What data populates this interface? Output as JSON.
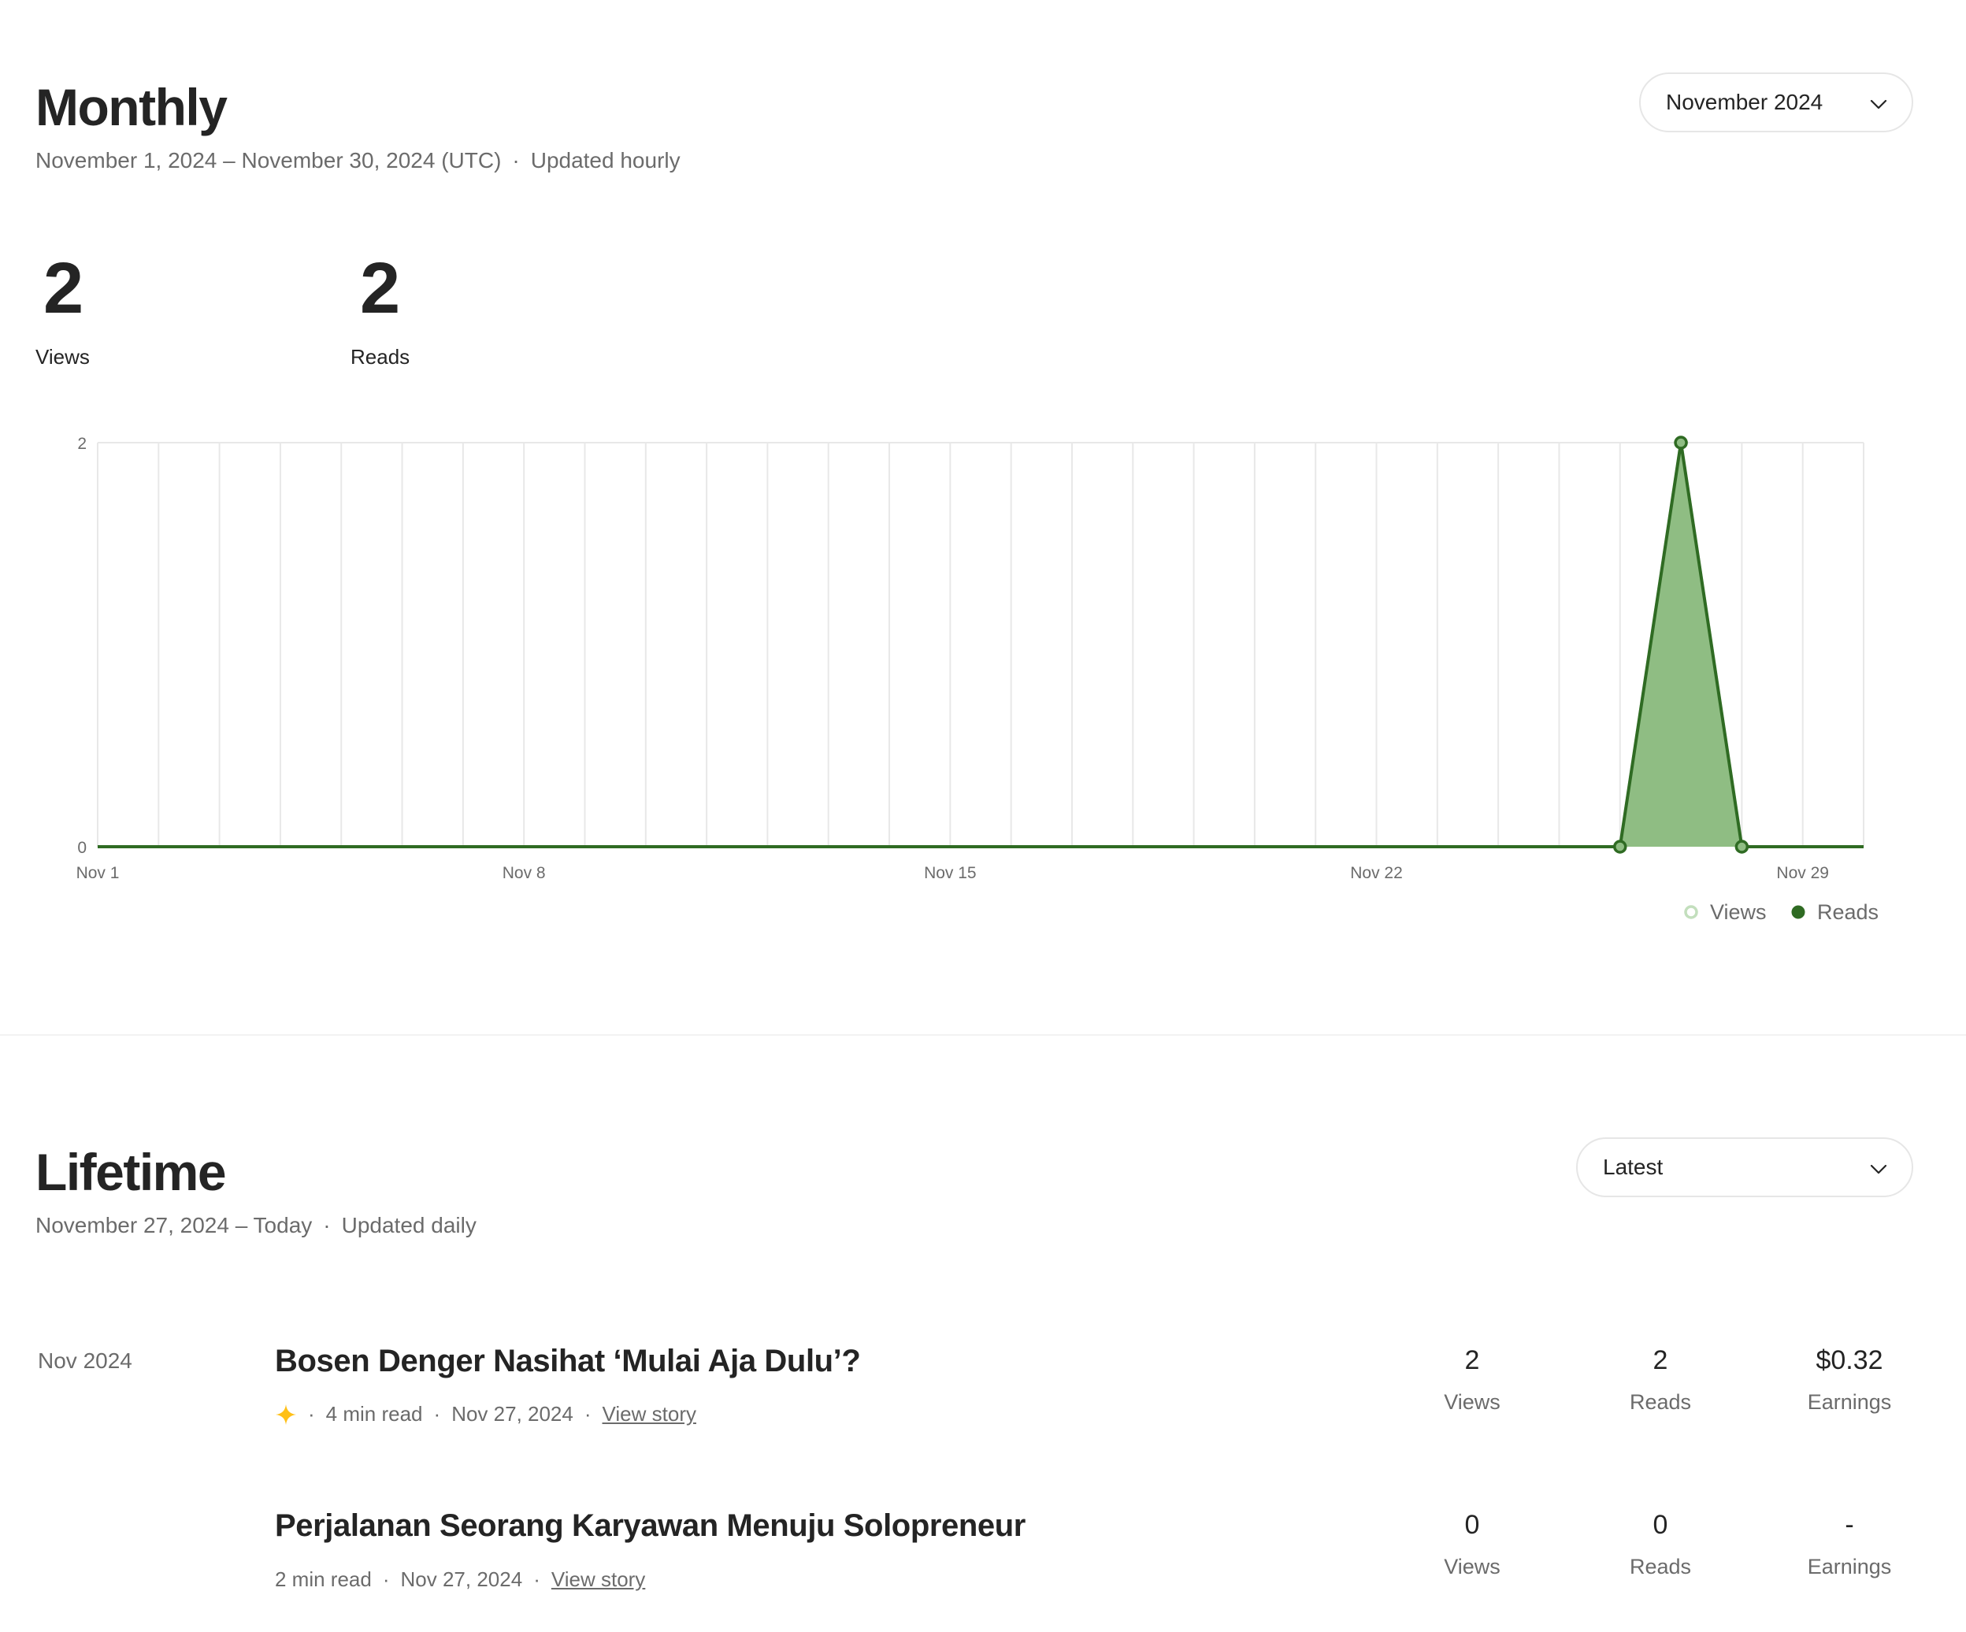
{
  "monthly": {
    "title": "Monthly",
    "range": "November 1, 2024 – November 30, 2024 (UTC)",
    "separator": "·",
    "update_note": "Updated hourly",
    "month_selector": "November 2024",
    "totals": [
      {
        "value": "2",
        "label": "Views"
      },
      {
        "value": "2",
        "label": "Reads"
      }
    ]
  },
  "chart_data": {
    "type": "area",
    "x": [
      "Nov 1",
      "Nov 2",
      "Nov 3",
      "Nov 4",
      "Nov 5",
      "Nov 6",
      "Nov 7",
      "Nov 8",
      "Nov 9",
      "Nov 10",
      "Nov 11",
      "Nov 12",
      "Nov 13",
      "Nov 14",
      "Nov 15",
      "Nov 16",
      "Nov 17",
      "Nov 18",
      "Nov 19",
      "Nov 20",
      "Nov 21",
      "Nov 22",
      "Nov 23",
      "Nov 24",
      "Nov 25",
      "Nov 26",
      "Nov 27",
      "Nov 28",
      "Nov 29",
      "Nov 30"
    ],
    "x_tick_labels": [
      "Nov 1",
      "Nov 8",
      "Nov 15",
      "Nov 22",
      "Nov 29"
    ],
    "y_tick_labels": [
      "0",
      "2"
    ],
    "ylim": [
      0,
      2
    ],
    "grid": "vertical",
    "legend_position": "bottom-right",
    "series": [
      {
        "name": "Views",
        "color": "#c3dfbd",
        "values": [
          0,
          0,
          0,
          0,
          0,
          0,
          0,
          0,
          0,
          0,
          0,
          0,
          0,
          0,
          0,
          0,
          0,
          0,
          0,
          0,
          0,
          0,
          0,
          0,
          0,
          0,
          2,
          0,
          0,
          0
        ]
      },
      {
        "name": "Reads",
        "color": "#2f6b23",
        "fill": "#8fbd83",
        "values": [
          0,
          0,
          0,
          0,
          0,
          0,
          0,
          0,
          0,
          0,
          0,
          0,
          0,
          0,
          0,
          0,
          0,
          0,
          0,
          0,
          0,
          0,
          0,
          0,
          0,
          0,
          2,
          0,
          0,
          0
        ]
      }
    ],
    "title": "",
    "xlabel": "",
    "ylabel": ""
  },
  "lifetime": {
    "title": "Lifetime",
    "range": "November 27, 2024 – Today",
    "separator": "·",
    "update_note": "Updated daily",
    "sort_selector": "Latest",
    "group_date": "Nov 2024",
    "stories": [
      {
        "title": "Bosen Denger Nasihat ‘Mulai Aja Dulu’?",
        "has_star": true,
        "star_color": "#ffc017",
        "read_time": "4 min read",
        "date": "Nov 27, 2024",
        "link": "View story",
        "views": "2",
        "views_label": "Views",
        "reads": "2",
        "reads_label": "Reads",
        "earnings": "$0.32",
        "earnings_label": "Earnings"
      },
      {
        "title": "Perjalanan Seorang Karyawan Menuju Solopreneur",
        "has_star": false,
        "read_time": "2 min read",
        "date": "Nov 27, 2024",
        "link": "View story",
        "views": "0",
        "views_label": "Views",
        "reads": "0",
        "reads_label": "Reads",
        "earnings": "-",
        "earnings_label": "Earnings"
      }
    ]
  }
}
